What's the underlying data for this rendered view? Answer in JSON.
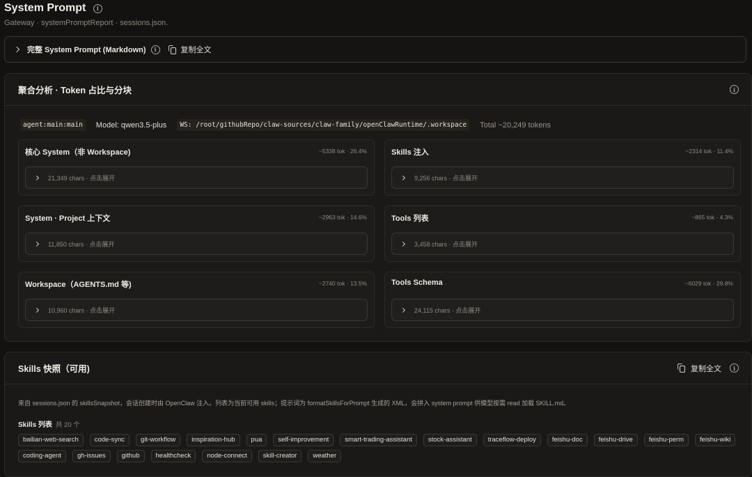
{
  "header": {
    "title": "System Prompt",
    "subtitle": "Gateway · systemPromptReport · sessions.json."
  },
  "prompt_bar": {
    "title": "完整 System Prompt (Markdown)",
    "copy_label": "复制全文"
  },
  "analysis": {
    "title": "聚合分析 · Token 占比与分块",
    "session_key": "agent:main:main",
    "model": "Model: qwen3.5-plus",
    "workspace": "WS: /root/githubRepo/claw-sources/claw-family/openClawRuntime/.workspace",
    "total": "Total ~20,249 tokens",
    "cards": [
      {
        "title": "核心 System（非 Workspace)",
        "stat": "~5338 tok · 26.4%",
        "expand": "21,349 chars · 点击展开"
      },
      {
        "title": "Skills 注入",
        "stat": "~2314 tok · 11.4%",
        "expand": "9,256 chars · 点击展开"
      },
      {
        "title": "System · Project 上下文",
        "stat": "~2963 tok · 14.6%",
        "expand": "11,850 chars · 点击展开"
      },
      {
        "title": "Tools 列表",
        "stat": "~865 tok · 4.3%",
        "expand": "3,458 chars · 点击展开"
      },
      {
        "title": "Workspace（AGENTS.md 等)",
        "stat": "~2740 tok · 13.5%",
        "expand": "10,960 chars · 点击展开"
      },
      {
        "title": "Tools Schema",
        "stat": "~6029 tok · 29.8%",
        "expand": "24,115 chars · 点击展开"
      }
    ]
  },
  "skills": {
    "title": "Skills 快照（可用)",
    "copy_label": "复制全文",
    "description": "来自 sessions.json 的 skillsSnapshot，会话创建时由 OpenClaw 注入。列表为当前可用 skills；提示词为 formatSkillsForPrompt 生成的 XML，会拼入 system prompt 供模型按需 read 加载 SKILL.md。",
    "list_label": "Skills 列表",
    "count": "共 20 个",
    "tags": [
      "bailian-web-search",
      "code-sync",
      "git-workflow",
      "inspiration-hub",
      "pua",
      "self-improvement",
      "smart-trading-assistant",
      "stock-assistant",
      "traceflow-deploy",
      "feishu-doc",
      "feishu-drive",
      "feishu-perm",
      "feishu-wiki",
      "coding-agent",
      "gh-issues",
      "github",
      "healthcheck",
      "node-connect",
      "skill-creator",
      "weather"
    ]
  }
}
